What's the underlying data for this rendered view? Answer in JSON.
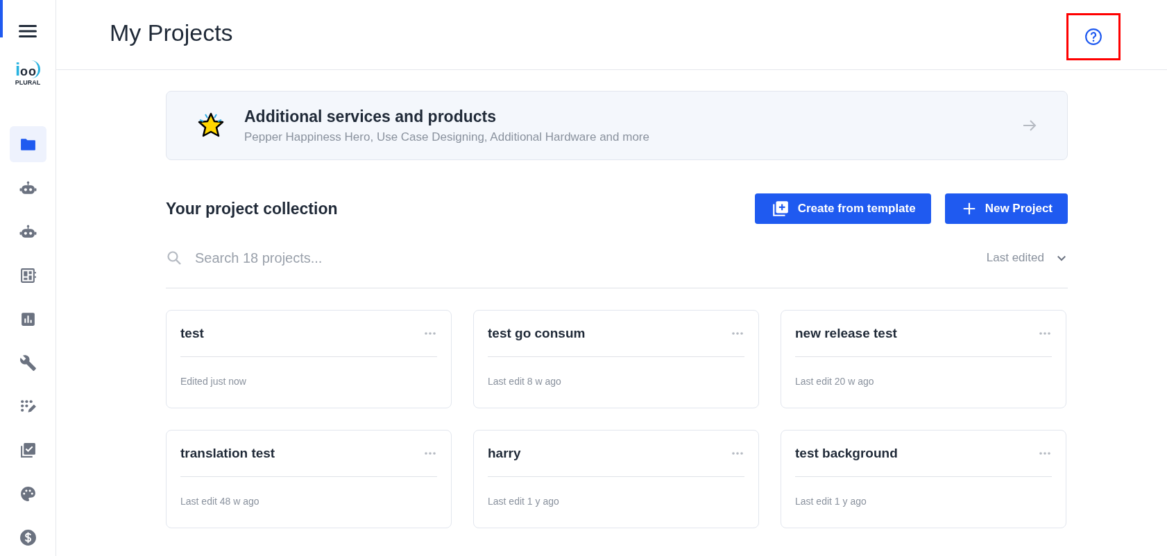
{
  "sidebar": {
    "logo": {
      "letter": "i",
      "eyes": "oo",
      "word": "PLURAL"
    },
    "items": [
      {
        "kind": "folder",
        "selected": true
      },
      {
        "kind": "robot",
        "selected": false
      },
      {
        "kind": "robot",
        "selected": false
      },
      {
        "kind": "dashboard",
        "selected": false
      },
      {
        "kind": "chart",
        "selected": false
      },
      {
        "kind": "wrench",
        "selected": false
      },
      {
        "kind": "dots-edit",
        "selected": false
      },
      {
        "kind": "checklist",
        "selected": false
      },
      {
        "kind": "palette",
        "selected": false
      },
      {
        "kind": "dollar",
        "selected": false
      }
    ]
  },
  "header": {
    "title": "My Projects",
    "help_highlighted": true
  },
  "banner": {
    "title": "Additional services and products",
    "subtitle": "Pepper Happiness Hero, Use Case Designing, Additional Hardware and more"
  },
  "collection": {
    "heading": "Your project collection",
    "buttons": [
      {
        "kind": "template",
        "label": "Create from template"
      },
      {
        "kind": "new",
        "label": "New Project"
      }
    ],
    "search": {
      "placeholder": "Search 18 projects..."
    },
    "sort": {
      "label": "Last edited"
    }
  },
  "projects": [
    {
      "name": "test",
      "edited": "Edited just now"
    },
    {
      "name": "test go consum",
      "edited": "Last edit 8 w ago"
    },
    {
      "name": "new release test",
      "edited": "Last edit 20 w ago"
    },
    {
      "name": "translation test",
      "edited": "Last edit 48 w ago"
    },
    {
      "name": "harry",
      "edited": "Last edit 1 y ago"
    },
    {
      "name": "test background",
      "edited": "Last edit 1 y ago"
    }
  ]
}
